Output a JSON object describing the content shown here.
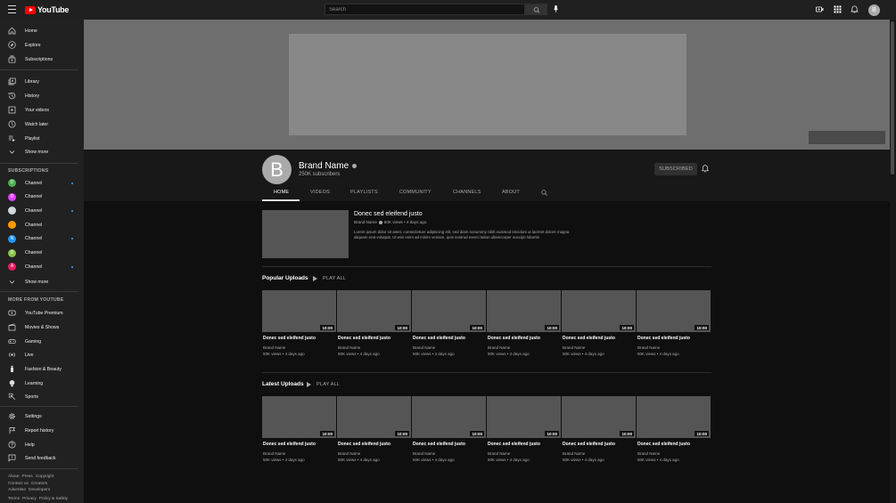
{
  "topbar": {
    "logo_text": "YouTube",
    "search_placeholder": "Search",
    "avatar_letter": "B"
  },
  "sidebar": {
    "main": [
      {
        "label": "Home",
        "icon": "home-icon"
      },
      {
        "label": "Explore",
        "icon": "compass-icon"
      },
      {
        "label": "Subscriptions",
        "icon": "subscriptions-icon"
      }
    ],
    "library": [
      {
        "label": "Library",
        "icon": "library-icon"
      },
      {
        "label": "History",
        "icon": "history-icon"
      },
      {
        "label": "Your videos",
        "icon": "your-videos-icon"
      },
      {
        "label": "Watch later",
        "icon": "clock-icon"
      },
      {
        "label": "Playlist",
        "icon": "playlist-icon"
      },
      {
        "label": "Show more",
        "icon": "chevron-down-icon"
      }
    ],
    "subscriptions_heading": "SUBSCRIPTIONS",
    "channels": [
      {
        "label": "Channel",
        "letter": "D",
        "color": "#4caf50",
        "live": true
      },
      {
        "label": "Channel",
        "letter": "D",
        "color": "#e040fb",
        "live": false
      },
      {
        "label": "Channel",
        "letter": "",
        "color": "#cfd8dc",
        "live": true
      },
      {
        "label": "Channel",
        "letter": "",
        "color": "#ff9800",
        "live": false
      },
      {
        "label": "Channel",
        "letter": "N",
        "color": "#2196f3",
        "live": true
      },
      {
        "label": "Channel",
        "letter": "D",
        "color": "#8bc34a",
        "live": false
      },
      {
        "label": "Channel",
        "letter": "A",
        "color": "#e91e63",
        "live": true
      }
    ],
    "channels_show_more": "Show more",
    "more_heading": "MORE FROM YOUTUBE",
    "more": [
      {
        "label": "YouTube Premium",
        "icon": "youtube-premium-icon"
      },
      {
        "label": "Movies & Shows",
        "icon": "movies-icon"
      },
      {
        "label": "Gaming",
        "icon": "gaming-icon"
      },
      {
        "label": "Live",
        "icon": "live-icon"
      },
      {
        "label": "Fashion & Beauty",
        "icon": "fashion-icon"
      },
      {
        "label": "Learning",
        "icon": "learning-icon"
      },
      {
        "label": "Sports",
        "icon": "sports-icon"
      }
    ],
    "settings": [
      {
        "label": "Settings",
        "icon": "gear-icon"
      },
      {
        "label": "Report history",
        "icon": "flag-icon"
      },
      {
        "label": "Help",
        "icon": "help-icon"
      },
      {
        "label": "Send feedback",
        "icon": "feedback-icon"
      }
    ],
    "footer_rows": [
      [
        "About",
        "Press",
        "Copyright"
      ],
      [
        "Contact us",
        "Creators"
      ],
      [
        "Advertise",
        "Developers"
      ],
      [
        "Terms",
        "Privacy",
        "Policy & Safety"
      ]
    ]
  },
  "channel": {
    "avatar_letter": "B",
    "name": "Brand Name",
    "subscribers": "250K subscribers",
    "subscribed_label": "SUBSCRIBED",
    "tabs": [
      "HOME",
      "VIDEOS",
      "PLAYLISTS",
      "COMMUNITY",
      "CHANNELS",
      "ABOUT"
    ]
  },
  "featured": {
    "title": "Donec sed eleifend justo",
    "channel": "Brand Name",
    "meta": "50K views • 4 days ago",
    "description": "Lorem ipsum dolor sit amet, consectetuer adipiscing elit, sed diam nonummy nibh euismod tincidunt ut laoreet dolore magna aliquam erat volutpat. Ut wisi enim ad minim veniam, quis nostrud exerci tation ullamcorper suscipit lobortis"
  },
  "shelves": [
    {
      "title": "Popular Uploads",
      "play_all": "PLAY ALL",
      "videos": [
        {
          "duration": "10:00",
          "title": "Donec sed eleifend justo",
          "channel": "Brand Name",
          "meta": "50K views • 4 days ago"
        },
        {
          "duration": "10:00",
          "title": "Donec sed eleifend justo",
          "channel": "Brand Name",
          "meta": "50K views • 4 days ago"
        },
        {
          "duration": "10:00",
          "title": "Donec sed eleifend justo",
          "channel": "Brand Name",
          "meta": "50K views • 4 days ago"
        },
        {
          "duration": "10:00",
          "title": "Donec sed eleifend justo",
          "channel": "Brand Name",
          "meta": "50K views • 4 days ago"
        },
        {
          "duration": "10:00",
          "title": "Donec sed eleifend justo",
          "channel": "Brand Name",
          "meta": "50K views • 4 days ago"
        },
        {
          "duration": "10:00",
          "title": "Donec sed eleifend justo",
          "channel": "Brand Name",
          "meta": "50K views • 4 days ago"
        }
      ]
    },
    {
      "title": "Latest Uploads",
      "play_all": "PLAY ALL",
      "videos": [
        {
          "duration": "10:00",
          "title": "Donec sed eleifend justo",
          "channel": "Brand Name",
          "meta": "50K views • 4 days ago"
        },
        {
          "duration": "10:00",
          "title": "Donec sed eleifend justo",
          "channel": "Brand Name",
          "meta": "50K views • 4 days ago"
        },
        {
          "duration": "10:00",
          "title": "Donec sed eleifend justo",
          "channel": "Brand Name",
          "meta": "50K views • 4 days ago"
        },
        {
          "duration": "10:00",
          "title": "Donec sed eleifend justo",
          "channel": "Brand Name",
          "meta": "50K views • 4 days ago"
        },
        {
          "duration": "10:00",
          "title": "Donec sed eleifend justo",
          "channel": "Brand Name",
          "meta": "50K views • 4 days ago"
        },
        {
          "duration": "10:00",
          "title": "Donec sed eleifend justo",
          "channel": "Brand Name",
          "meta": "50K views • 4 days ago"
        }
      ]
    }
  ]
}
